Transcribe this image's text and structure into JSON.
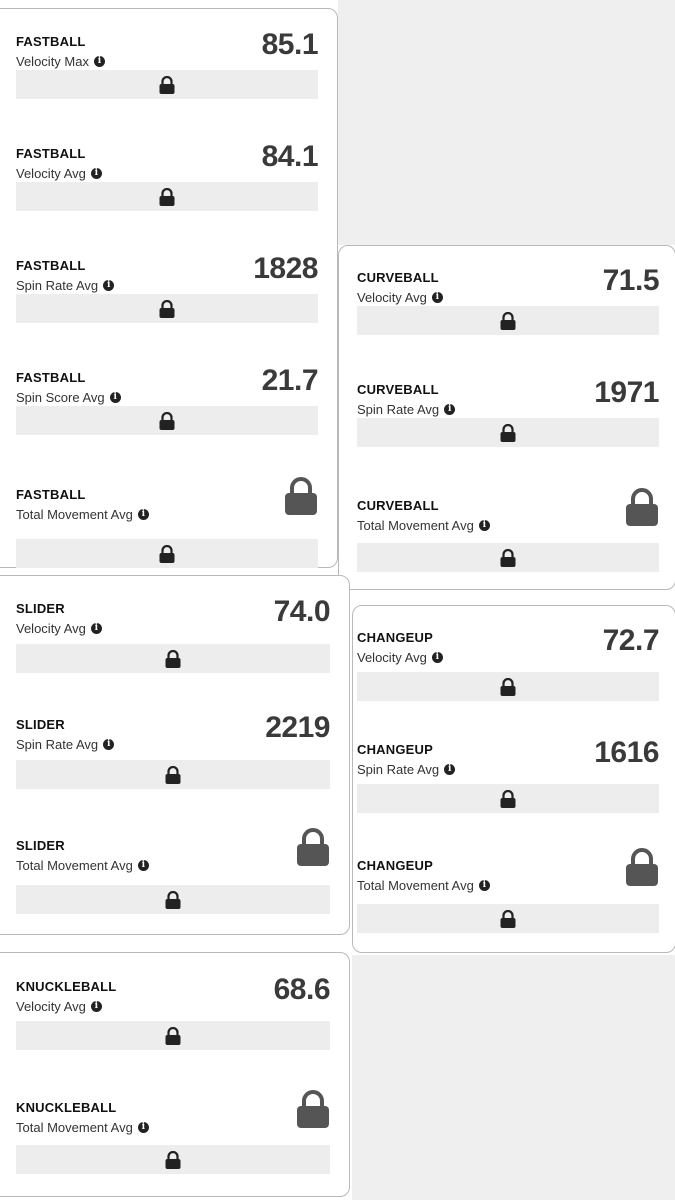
{
  "info_glyph": "i",
  "lock_color": "#222222",
  "big_lock_color": "#555555",
  "bar_color": "#ededed",
  "cards": {
    "fastball": {
      "metrics": [
        {
          "pitch": "FASTBALL",
          "label": "Velocity Max",
          "value": "85.1"
        },
        {
          "pitch": "FASTBALL",
          "label": "Velocity Avg",
          "value": "84.1"
        },
        {
          "pitch": "FASTBALL",
          "label": "Spin Rate Avg",
          "value": "1828"
        },
        {
          "pitch": "FASTBALL",
          "label": "Spin Score Avg",
          "value": "21.7"
        },
        {
          "pitch": "FASTBALL",
          "label": "Total Movement Avg",
          "value_icon": "lock-icon"
        }
      ]
    },
    "curveball": {
      "metrics": [
        {
          "pitch": "CURVEBALL",
          "label": "Velocity Avg",
          "value": "71.5"
        },
        {
          "pitch": "CURVEBALL",
          "label": "Spin Rate Avg",
          "value": "1971"
        },
        {
          "pitch": "CURVEBALL",
          "label": "Total Movement Avg",
          "value_icon": "lock-icon"
        }
      ]
    },
    "slider": {
      "metrics": [
        {
          "pitch": "SLIDER",
          "label": "Velocity Avg",
          "value": "74.0"
        },
        {
          "pitch": "SLIDER",
          "label": "Spin Rate Avg",
          "value": "2219"
        },
        {
          "pitch": "SLIDER",
          "label": "Total Movement Avg",
          "value_icon": "lock-icon"
        }
      ]
    },
    "changeup": {
      "metrics": [
        {
          "pitch": "CHANGEUP",
          "label": "Velocity Avg",
          "value": "72.7"
        },
        {
          "pitch": "CHANGEUP",
          "label": "Spin Rate Avg",
          "value": "1616"
        },
        {
          "pitch": "CHANGEUP",
          "label": "Total Movement Avg",
          "value_icon": "lock-icon"
        }
      ]
    },
    "knuckleball": {
      "metrics": [
        {
          "pitch": "KNUCKLEBALL",
          "label": "Velocity Avg",
          "value": "68.6"
        },
        {
          "pitch": "KNUCKLEBALL",
          "label": "Total Movement Avg",
          "value_icon": "lock-icon"
        }
      ]
    }
  }
}
